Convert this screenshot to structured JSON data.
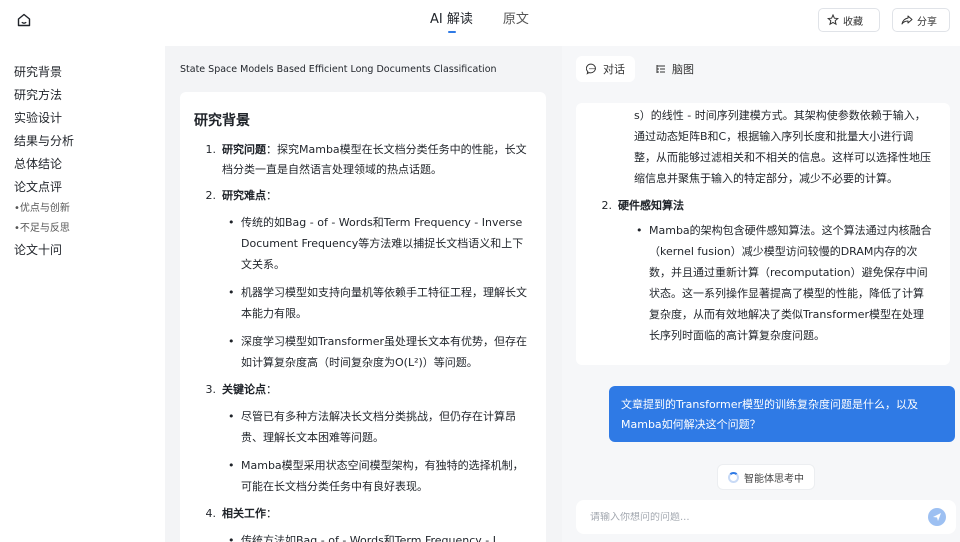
{
  "header": {
    "tabs": [
      "AI 解读",
      "原文"
    ],
    "favorite_label": "收藏",
    "share_label": "分享"
  },
  "nav": {
    "items": [
      "研究背景",
      "研究方法",
      "实验设计",
      "结果与分析",
      "总体结论",
      "论文点评",
      "•优点与创新",
      "•不足与反思",
      "论文十问"
    ]
  },
  "doc": {
    "paper_title": "State Space Models Based Efficient Long Documents Classification",
    "heading": "研究背景",
    "sections": [
      {
        "num": "1.",
        "label": "研究问题",
        "text": "：探究Mamba模型在长文档分类任务中的性能，长文档分类一直是自然语言处理领域的热点话题。",
        "bullets": []
      },
      {
        "num": "2.",
        "label": "研究难点",
        "text": "：",
        "bullets": [
          "传统的如Bag - of - Words和Term Frequency - Inverse Document Frequency等方法难以捕捉长文档语义和上下文关系。",
          "机器学习模型如支持向量机等依赖手工特征工程，理解长文本能力有限。",
          "深度学习模型如Transformer虽处理长文本有优势，但存在如计算复杂度高（时间复杂度为O(L²)）等问题。"
        ]
      },
      {
        "num": "3.",
        "label": "关键论点",
        "text": "：",
        "bullets": [
          "尽管已有多种方法解决长文档分类挑战，但仍存在计算昂贵、理解长文本困难等问题。",
          "Mamba模型采用状态空间模型架构，有独特的选择机制，可能在长文档分类任务中有良好表现。"
        ]
      },
      {
        "num": "4.",
        "label": "相关工作",
        "text": "：",
        "bullets": [
          "传统方法如Bag - of - Words和Term Frequency - I"
        ]
      }
    ]
  },
  "chat": {
    "tabs": [
      "对话",
      "脑图"
    ],
    "answer": {
      "continuation": "s）的线性 - 时间序列建模方式。其架构使参数依赖于输入，通过动态矩阵B和C，根据输入序列长度和批量大小进行调整，从而能够过滤相关和不相关的信息。这样可以选择性地压缩信息并聚焦于输入的特定部分，减少不必要的计算。",
      "section_num": "2.",
      "section_label": "硬件感知算法",
      "bullets": [
        "Mamba的架构包含硬件感知算法。这个算法通过内核融合（kernel fusion）减少模型访问较慢的DRAM内存的次数，并且通过重新计算（recomputation）避免保存中间状态。这一系列操作显著提高了模型的性能，降低了计算复杂度，从而有效地解决了类似Transformer模型在处理长序列时面临的高计算复杂度问题。"
      ]
    },
    "user_message": "文章提到的Transformer模型的训练复杂度问题是什么，以及Mamba如何解决这个问题？",
    "thinking_label": "智能体思考中",
    "input_placeholder": "请输入你想问的问题..."
  }
}
